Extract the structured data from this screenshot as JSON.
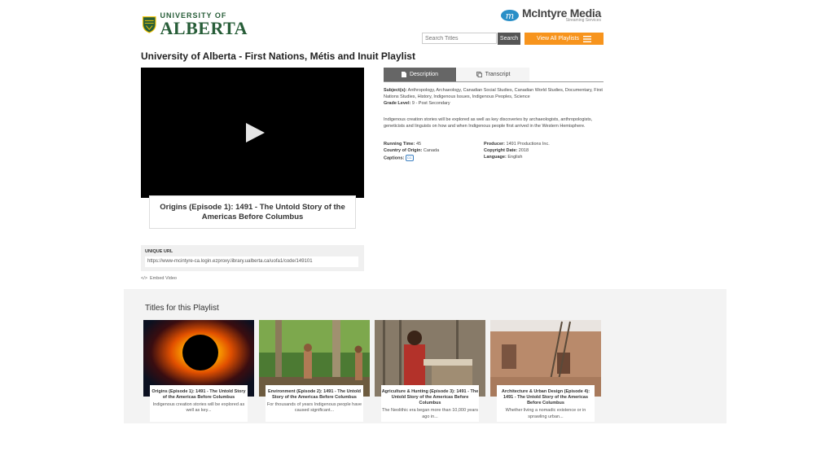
{
  "header": {
    "ua_logo_line1": "UNIVERSITY OF",
    "ua_logo_line2": "ALBERTA",
    "mcintyre_name": "McIntyre Media",
    "mcintyre_tagline": "Streaming Services",
    "search_placeholder": "Search Titles",
    "search_button": "Search",
    "view_all_button": "View All Playlists"
  },
  "page_title": "University of Alberta - First Nations, Métis and Inuit Playlist",
  "video": {
    "caption": "Origins (Episode 1): 1491 - The Untold Story of the Americas Before Columbus",
    "url_label": "UNIQUE URL",
    "url": "https://www-mcintyre-ca.login.ezproxy.library.ualberta.ca/uofa1/code/149101",
    "embed_label": "Embed Video"
  },
  "tabs": {
    "description": "Description",
    "transcript": "Transcript"
  },
  "details": {
    "subjects_label": "Subject(s):",
    "subjects": "Anthropology, Archaeology, Canadian Social Studies, Canadian World Studies, Documentary, First Nations Studies, History, Indigenous Issues, Indigenous Peoples, Science",
    "grade_label": "Grade Level:",
    "grade": "9 - Post Secondary",
    "description": "Indigenous creation stories will be explored as well as key discoveries by archaeologists, anthropologists, geneticists and linguists on how and when Indigenous people first arrived in the Western Hemisphere.",
    "running_time_label": "Running Time:",
    "running_time": "45",
    "country_label": "Country of Origin:",
    "country": "Canada",
    "captions_label": "Captions:",
    "captions_badge": "CC",
    "producer_label": "Producer:",
    "producer": "1491 Productions Inc.",
    "copyright_label": "Copyright Date:",
    "copyright": "2018",
    "language_label": "Language:",
    "language": "English"
  },
  "playlist": {
    "heading": "Titles for this Playlist",
    "cards": [
      {
        "title": "Origins (Episode 1): 1491 - The Untold Story of the Americas Before Columbus",
        "desc": "Indigenous creation stories will be explored as well as key..."
      },
      {
        "title": "Environment (Episode 2): 1491 - The Untold Story of the Americas Before Columbus",
        "desc": "For thousands of years Indigenous people have caused significant..."
      },
      {
        "title": "Agriculture & Hunting (Episode 3): 1491 - The Untold Story of the Americas Before Columbus",
        "desc": "The Neolithic era began more than 10,000 years ago in..."
      },
      {
        "title": "Architecture & Urban Design (Episode 4): 1491 - The Untold Story of the Americas Before Columbus",
        "desc": "Whether living a nomadic existence or in sprawling urban..."
      }
    ]
  },
  "colors": {
    "ua_green": "#275d38",
    "accent_orange": "#f7941d",
    "tab_active": "#666666"
  }
}
